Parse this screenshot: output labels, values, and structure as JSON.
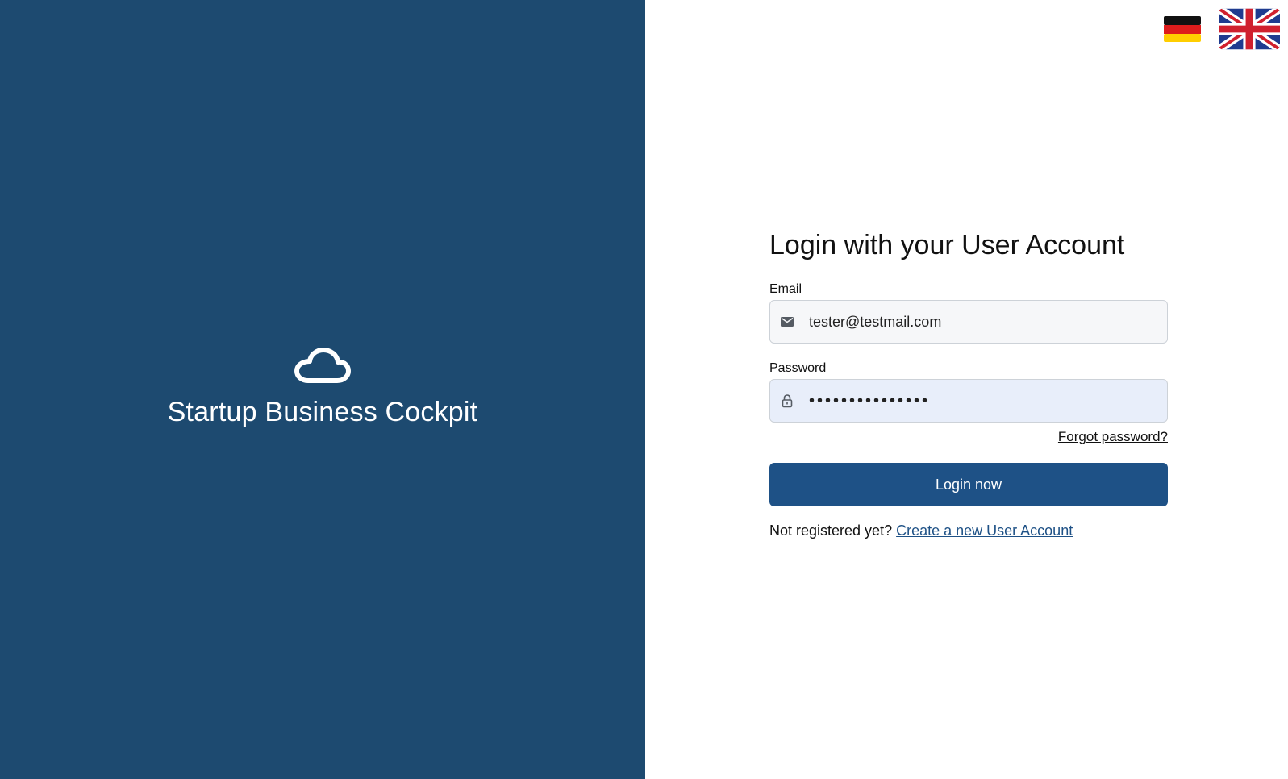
{
  "brand": {
    "title": "Startup Business Cockpit",
    "icon": "cloud-icon",
    "panel_color": "#1d4a70"
  },
  "language_switcher": {
    "options": [
      {
        "code": "de",
        "icon": "german-flag-icon"
      },
      {
        "code": "en",
        "icon": "uk-flag-icon"
      }
    ]
  },
  "login_form": {
    "title": "Login with your User Account",
    "email": {
      "label": "Email",
      "value": "tester@testmail.com",
      "icon": "envelope-icon"
    },
    "password": {
      "label": "Password",
      "value": "•••••••••••••••",
      "icon": "lock-icon"
    },
    "forgot_password": "Forgot password?",
    "submit_label": "Login now",
    "submit_color": "#1e5186",
    "register_prompt": "Not registered yet?",
    "register_link": "Create a new User Account"
  }
}
